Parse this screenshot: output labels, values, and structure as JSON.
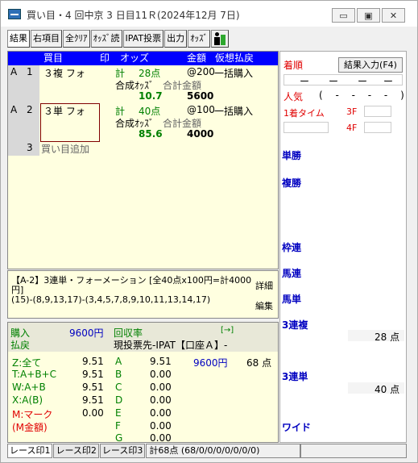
{
  "window": {
    "title": "買い目・4 回中京 3 日目11Ｒ(2024年12月 7日)",
    "minimize": "▭",
    "maximize": "▣",
    "close": "✕"
  },
  "toolbar": {
    "buttons": [
      "結果",
      "右項目",
      "全ｸﾘｱ",
      "ｵｯｽﾞ読",
      "IPAT投票",
      "出力",
      "ｵｯｽﾞ"
    ]
  },
  "table_header": {
    "buy": "買目",
    "mark": "印",
    "odds": "オッズ",
    "amount": "金額",
    "payout": "仮想払戻"
  },
  "rows": [
    {
      "id": "A",
      "num": "1",
      "bet": "３複 フォ",
      "points_label": "計",
      "points": "28点",
      "unit": "@200",
      "method": "一括購入",
      "sub_odds_label": "合成ｵｯｽﾞ",
      "sub_total_label": "合計金額",
      "odds": "10.7",
      "total": "5600"
    },
    {
      "id": "A",
      "num": "2",
      "bet": "３単 フォ",
      "points_label": "計",
      "points": "40点",
      "unit": "@100",
      "method": "一括購入",
      "sub_odds_label": "合成ｵｯｽﾞ",
      "sub_total_label": "合計金額",
      "odds": "85.6",
      "total": "4000"
    }
  ],
  "add_row": {
    "num": "3",
    "label": "買い目追加"
  },
  "description": {
    "line1": "【A-2】3連単・フォーメーション [全40点x100円=計4000",
    "line2": "円]",
    "line3": "(15)-(8,9,13,17)-(3,4,5,7,8,9,10,11,13,14,17)",
    "detail": "詳細",
    "edit": "編集"
  },
  "summary": {
    "purchase_label": "購入",
    "purchase_value": "9600円",
    "recovery_label": "回収率",
    "arrow": "[→]",
    "refund_label": "払戻",
    "target": "現投票先-IPAT【口座Ａ】-",
    "left_items": [
      {
        "key": "Z:全て",
        "val": "9.51"
      },
      {
        "key": "T:A+B+C",
        "val": "9.51"
      },
      {
        "key": "W:A+B",
        "val": "9.51"
      },
      {
        "key": "X:A(B)",
        "val": "9.51"
      },
      {
        "key": "M:マーク",
        "val": "0.00"
      },
      {
        "key": "(M金額)",
        "val": ""
      }
    ],
    "right_items": [
      {
        "key": "A",
        "val": "9.51",
        "amt": "9600円",
        "pts": "68 点"
      },
      {
        "key": "B",
        "val": "0.00",
        "amt": "",
        "pts": ""
      },
      {
        "key": "C",
        "val": "0.00",
        "amt": "",
        "pts": ""
      },
      {
        "key": "D",
        "val": "0.00",
        "amt": "",
        "pts": ""
      },
      {
        "key": "E",
        "val": "0.00",
        "amt": "",
        "pts": ""
      },
      {
        "key": "F",
        "val": "0.00",
        "amt": "",
        "pts": ""
      },
      {
        "key": "G",
        "val": "0.00",
        "amt": "",
        "pts": ""
      }
    ]
  },
  "right_panel": {
    "order_label": "着順",
    "result_button": "結果入力(F4)",
    "dashes": [
      "ー",
      "ー",
      "ー",
      "ー"
    ],
    "popularity_label": "人気",
    "popularity_value": "( - - - - )",
    "first_time_label": "1着タイム",
    "f3": "3F",
    "f4": "4F",
    "bet_types": [
      "単勝",
      "複勝",
      "枠連",
      "馬連",
      "馬単",
      "3連複",
      "3連単",
      "ワイド"
    ],
    "trio_points": "28 点",
    "trifecta_points": "40 点"
  },
  "statusbar": {
    "tabs": [
      "レース印1",
      "レース印2",
      "レース印3"
    ],
    "total": "計68点 (68/0/0/0/0/0/0/0)"
  },
  "colors": {
    "header_bg": "#0000ff",
    "panel_bg": "#ffffe0",
    "accent_red": "#e00000",
    "accent_blue": "#0000c0",
    "odds_green": "#008000"
  }
}
